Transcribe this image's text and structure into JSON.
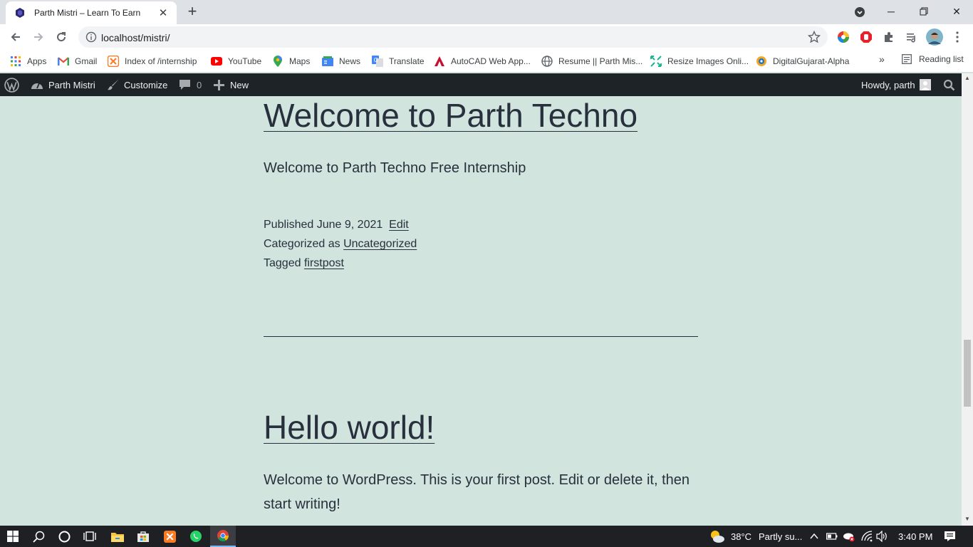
{
  "browser": {
    "tab_title": "Parth Mistri – Learn To Earn",
    "url": "localhost/mistri/",
    "bookmarks": [
      {
        "label": "Apps",
        "icon": "apps-grid-icon"
      },
      {
        "label": "Gmail",
        "icon": "gmail-icon"
      },
      {
        "label": "Index of /internship",
        "icon": "xampp-icon"
      },
      {
        "label": "YouTube",
        "icon": "youtube-icon"
      },
      {
        "label": "Maps",
        "icon": "maps-pin-icon"
      },
      {
        "label": "News",
        "icon": "news-icon"
      },
      {
        "label": "Translate",
        "icon": "translate-icon"
      },
      {
        "label": "AutoCAD Web App...",
        "icon": "autocad-icon"
      },
      {
        "label": "Resume || Parth Mis...",
        "icon": "globe-icon"
      },
      {
        "label": "Resize Images Onli...",
        "icon": "resize-icon"
      },
      {
        "label": "DigitalGujarat-Alpha",
        "icon": "digitalgujarat-icon"
      }
    ],
    "more_bookmarks": "»",
    "reading_list": "Reading list"
  },
  "adminbar": {
    "site_name": "Parth Mistri",
    "customize": "Customize",
    "comments_count": "0",
    "new_label": "New",
    "howdy": "Howdy, parth"
  },
  "posts": [
    {
      "title": "Welcome to Parth Techno",
      "excerpt": "Welcome to Parth Techno Free Internship",
      "published_prefix": "Published",
      "published_date": "June 9, 2021",
      "edit_label": "Edit",
      "categorized_prefix": "Categorized as",
      "category": "Uncategorized",
      "tagged_prefix": "Tagged",
      "tag": "firstpost"
    },
    {
      "title": "Hello world!",
      "excerpt_line1": "Welcome to WordPress. This is your first post. Edit or delete it, then",
      "excerpt_line2": "start writing!"
    }
  ],
  "taskbar": {
    "weather_temp": "38°C",
    "weather_desc": "Partly su...",
    "time": "3:40 PM"
  },
  "colors": {
    "page_bg": "#d1e4dd",
    "text": "#28303d",
    "adminbar_bg": "#1d2327",
    "taskbar_bg": "#1f2024"
  }
}
